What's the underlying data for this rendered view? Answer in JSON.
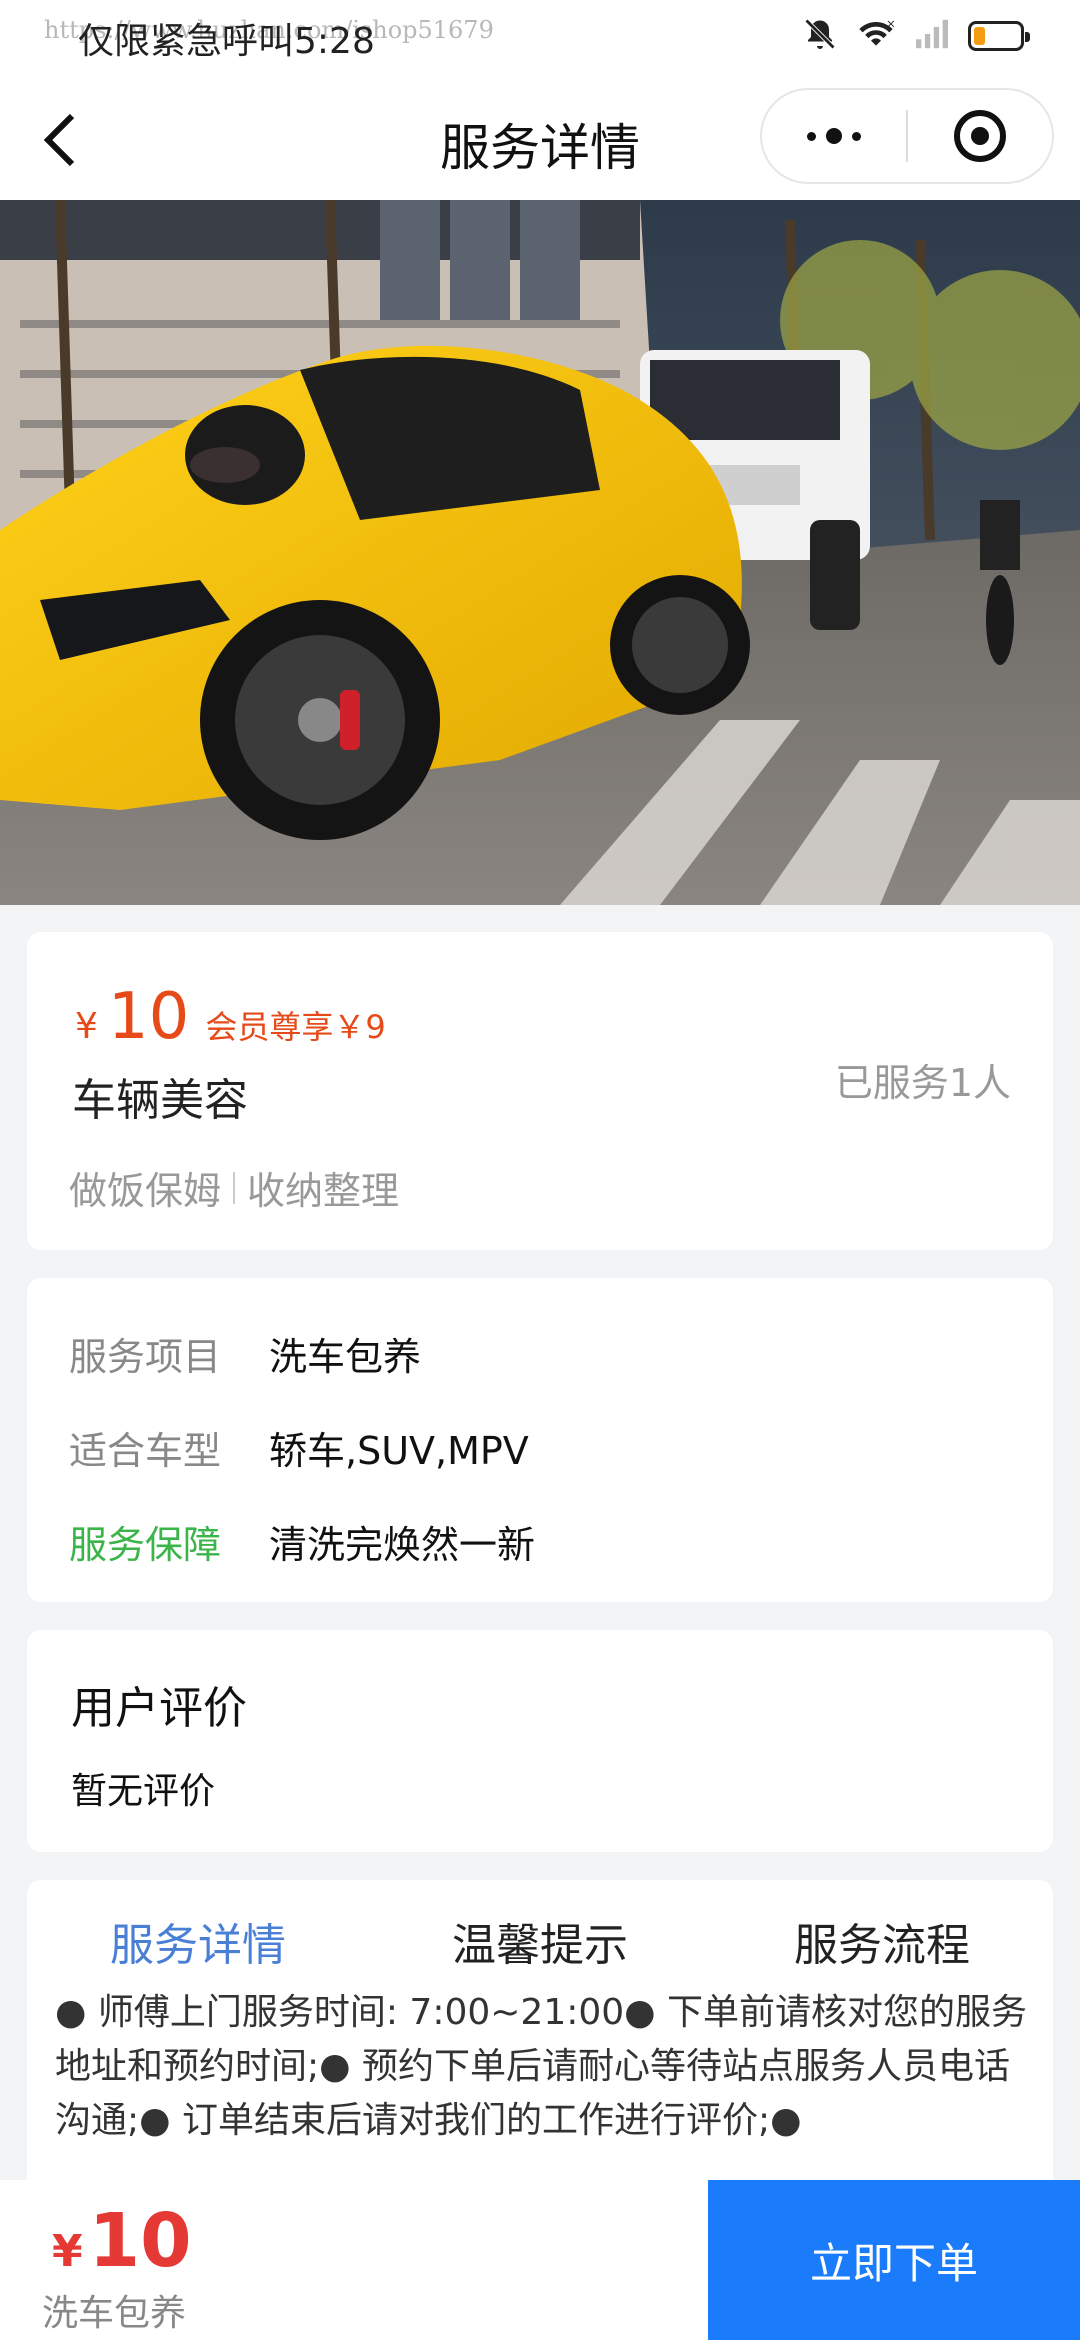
{
  "status_bar": {
    "left_text": "仅限紧急呼叫5:28",
    "watermark": "https://www.huzhan.com/ishop51679",
    "battery_level": 0.25,
    "icons": [
      "bell-off-icon",
      "wifi-icon",
      "signal-icon",
      "battery-icon"
    ]
  },
  "nav": {
    "title": "服务详情",
    "icons": [
      "back-arrow-icon",
      "more-dots-icon",
      "close-target-icon"
    ]
  },
  "price_card": {
    "currency": "¥",
    "price": "10",
    "member_price": "会员尊享￥9",
    "service_name": "车辆美容",
    "served_count": "已服务1人",
    "tags": [
      "做饭保姆",
      "收纳整理"
    ]
  },
  "info_card": {
    "rows": [
      {
        "label": "服务项目",
        "value": "洗车包养"
      },
      {
        "label": "适合车型",
        "value": "轿车,SUV,MPV"
      },
      {
        "label": "服务保障",
        "value": "清洗完焕然一新"
      }
    ]
  },
  "reviews": {
    "title": "用户评价",
    "empty_text": "暂无评价"
  },
  "detail": {
    "tabs": [
      "服务详情",
      "温馨提示",
      "服务流程"
    ],
    "active_tab": 0,
    "text": "● 师傅上门服务时间: 7:00~21:00● 下单前请核对您的服务地址和预约时间;● 预约下单后请耐心等待站点服务人员电话沟通;● 订单结束后请对我们的工作进行评价;●"
  },
  "bottom_bar": {
    "currency": "¥",
    "price": "10",
    "service_name": "洗车包养",
    "order_button": "立即下单"
  },
  "colors": {
    "price_red": "#e64a19",
    "accent_blue": "#1a7cfa",
    "tab_active": "#4a7fd6",
    "guarantee_green": "#3bb44a"
  }
}
